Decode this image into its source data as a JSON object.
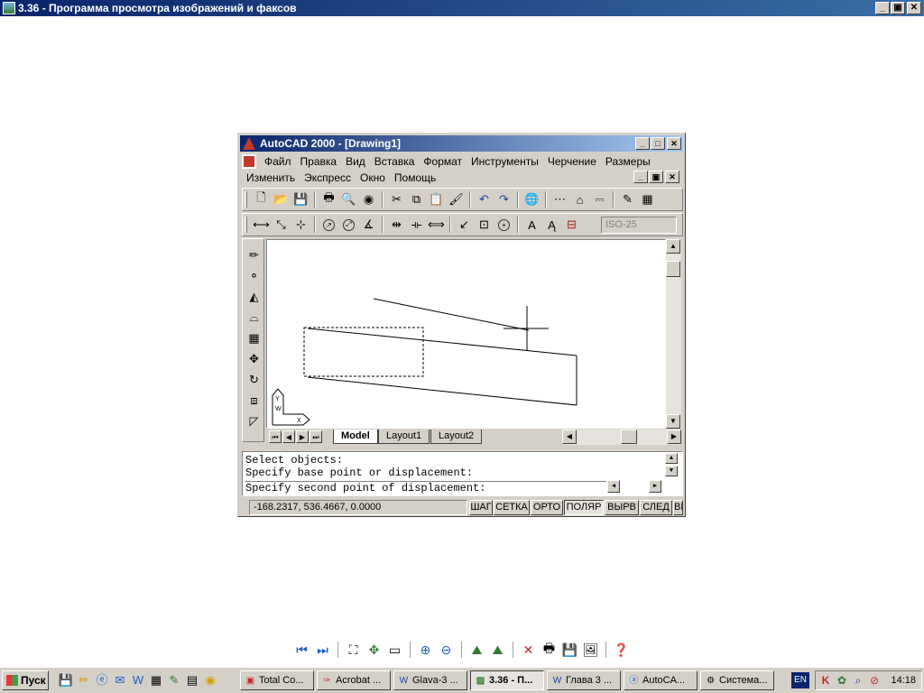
{
  "viewer_window": {
    "title": "3.36 - Программа просмотра изображений и факсов",
    "controls": {
      "minimize": "_",
      "maximize": "▣",
      "close": "✕"
    }
  },
  "acad": {
    "title": "AutoCAD 2000 - [Drawing1]",
    "controls": {
      "minimize": "_",
      "maximize": "□",
      "close": "✕",
      "doc_minimize": "_",
      "doc_restore": "▣",
      "doc_close": "✕"
    },
    "menu_row1": [
      "Файл",
      "Правка",
      "Вид",
      "Вставка",
      "Формат",
      "Инструменты",
      "Черчение",
      "Размеры"
    ],
    "menu_row2": [
      "Изменить",
      "Экспресс",
      "Окно",
      "Помощь"
    ],
    "dim_style": "ISO-25",
    "tabs": [
      "Model",
      "Layout1",
      "Layout2"
    ],
    "ucs": {
      "y": "Y",
      "w": "W",
      "x": "X"
    },
    "command_lines": [
      "Select objects:",
      "Specify base point or displacement:",
      "Specify second point of displacement:"
    ],
    "coords": "-168.2317, 536.4667, 0.0000",
    "status_buttons": [
      {
        "label": "ШАГ",
        "pressed": false
      },
      {
        "label": "СЕТКА",
        "pressed": false
      },
      {
        "label": "ОРТО",
        "pressed": false
      },
      {
        "label": "ПОЛЯР",
        "pressed": true
      },
      {
        "label": "ВЫРВ",
        "pressed": false
      },
      {
        "label": "СЛЕД",
        "pressed": false
      },
      {
        "label": "ВЕ",
        "pressed": false
      }
    ]
  },
  "taskbar": {
    "start_label": "Пуск",
    "tasks": [
      {
        "label": "Total Co...",
        "icon": "total-commander-icon",
        "active": false
      },
      {
        "label": "Acrobat ...",
        "icon": "acrobat-icon",
        "active": false
      },
      {
        "label": "Glava-3 ...",
        "icon": "word-icon",
        "active": false
      },
      {
        "label": "3.36 - П...",
        "icon": "image-viewer-icon",
        "active": true
      },
      {
        "label": "Глава 3 ...",
        "icon": "word-icon",
        "active": false
      },
      {
        "label": "AutoCA...",
        "icon": "autocad-icon",
        "active": false
      },
      {
        "label": "Система...",
        "icon": "system-icon",
        "active": false
      }
    ],
    "language": "EN",
    "clock": "14:18"
  }
}
